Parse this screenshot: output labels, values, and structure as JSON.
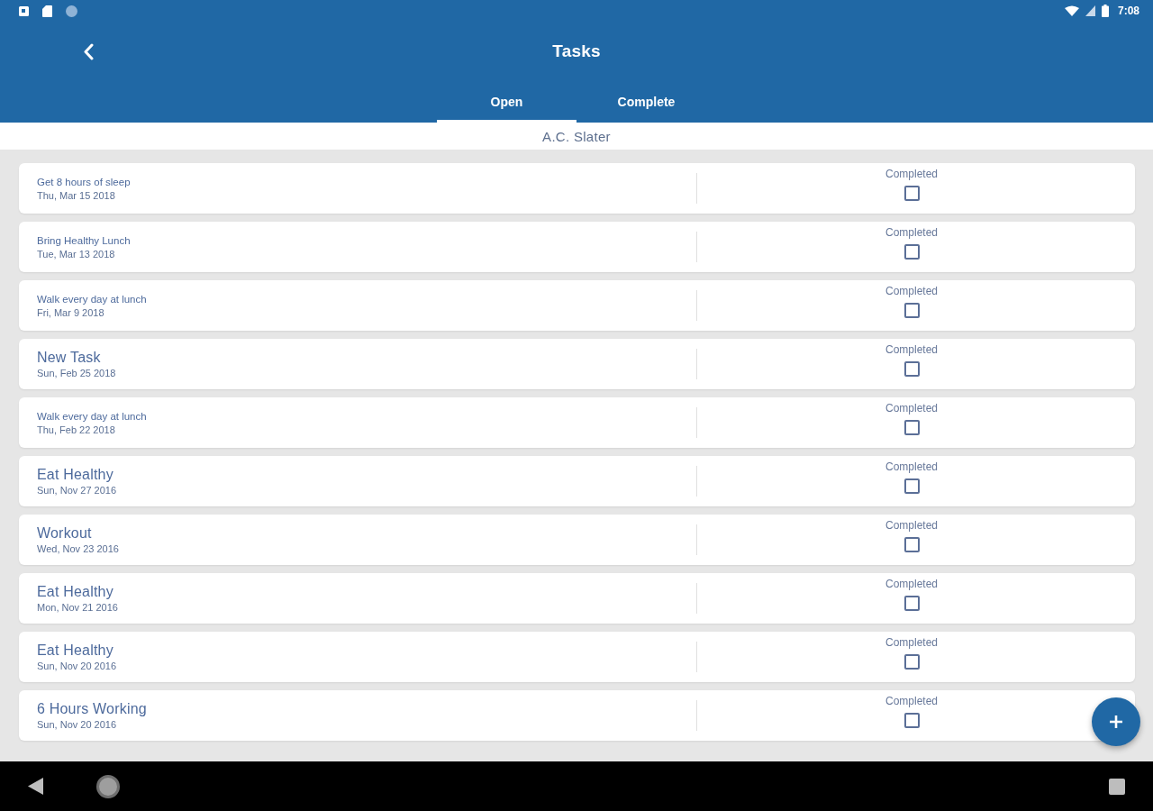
{
  "status_bar": {
    "time": "7:08"
  },
  "app_bar": {
    "title": "Tasks"
  },
  "tabs": [
    {
      "label": "Open",
      "selected": true
    },
    {
      "label": "Complete",
      "selected": false
    }
  ],
  "subheader": {
    "name": "A.C. Slater"
  },
  "tasks": [
    {
      "kind": "small",
      "title": "Get 8 hours of sleep",
      "date": "Thu, Mar 15 2018",
      "status_label": "Completed",
      "checked": false
    },
    {
      "kind": "small",
      "title": "Bring Healthy Lunch",
      "date": "Tue, Mar 13 2018",
      "status_label": "Completed",
      "checked": false
    },
    {
      "kind": "small",
      "title": "Walk every day at lunch",
      "date": "Fri, Mar 9 2018",
      "status_label": "Completed",
      "checked": false
    },
    {
      "kind": "large",
      "title": "New Task",
      "date": "Sun, Feb 25 2018",
      "status_label": "Completed",
      "checked": false
    },
    {
      "kind": "small",
      "title": "Walk every day at lunch",
      "date": "Thu, Feb 22 2018",
      "status_label": "Completed",
      "checked": false
    },
    {
      "kind": "large",
      "title": "Eat Healthy",
      "date": "Sun, Nov 27 2016",
      "status_label": "Completed",
      "checked": false
    },
    {
      "kind": "large",
      "title": "Workout",
      "date": "Wed, Nov 23 2016",
      "status_label": "Completed",
      "checked": false
    },
    {
      "kind": "large",
      "title": "Eat Healthy",
      "date": "Mon, Nov 21 2016",
      "status_label": "Completed",
      "checked": false
    },
    {
      "kind": "large",
      "title": "Eat Healthy",
      "date": "Sun, Nov 20 2016",
      "status_label": "Completed",
      "checked": false
    },
    {
      "kind": "large",
      "title": "6 Hours Working",
      "date": "Sun, Nov 20 2016",
      "status_label": "Completed",
      "checked": false
    }
  ]
}
